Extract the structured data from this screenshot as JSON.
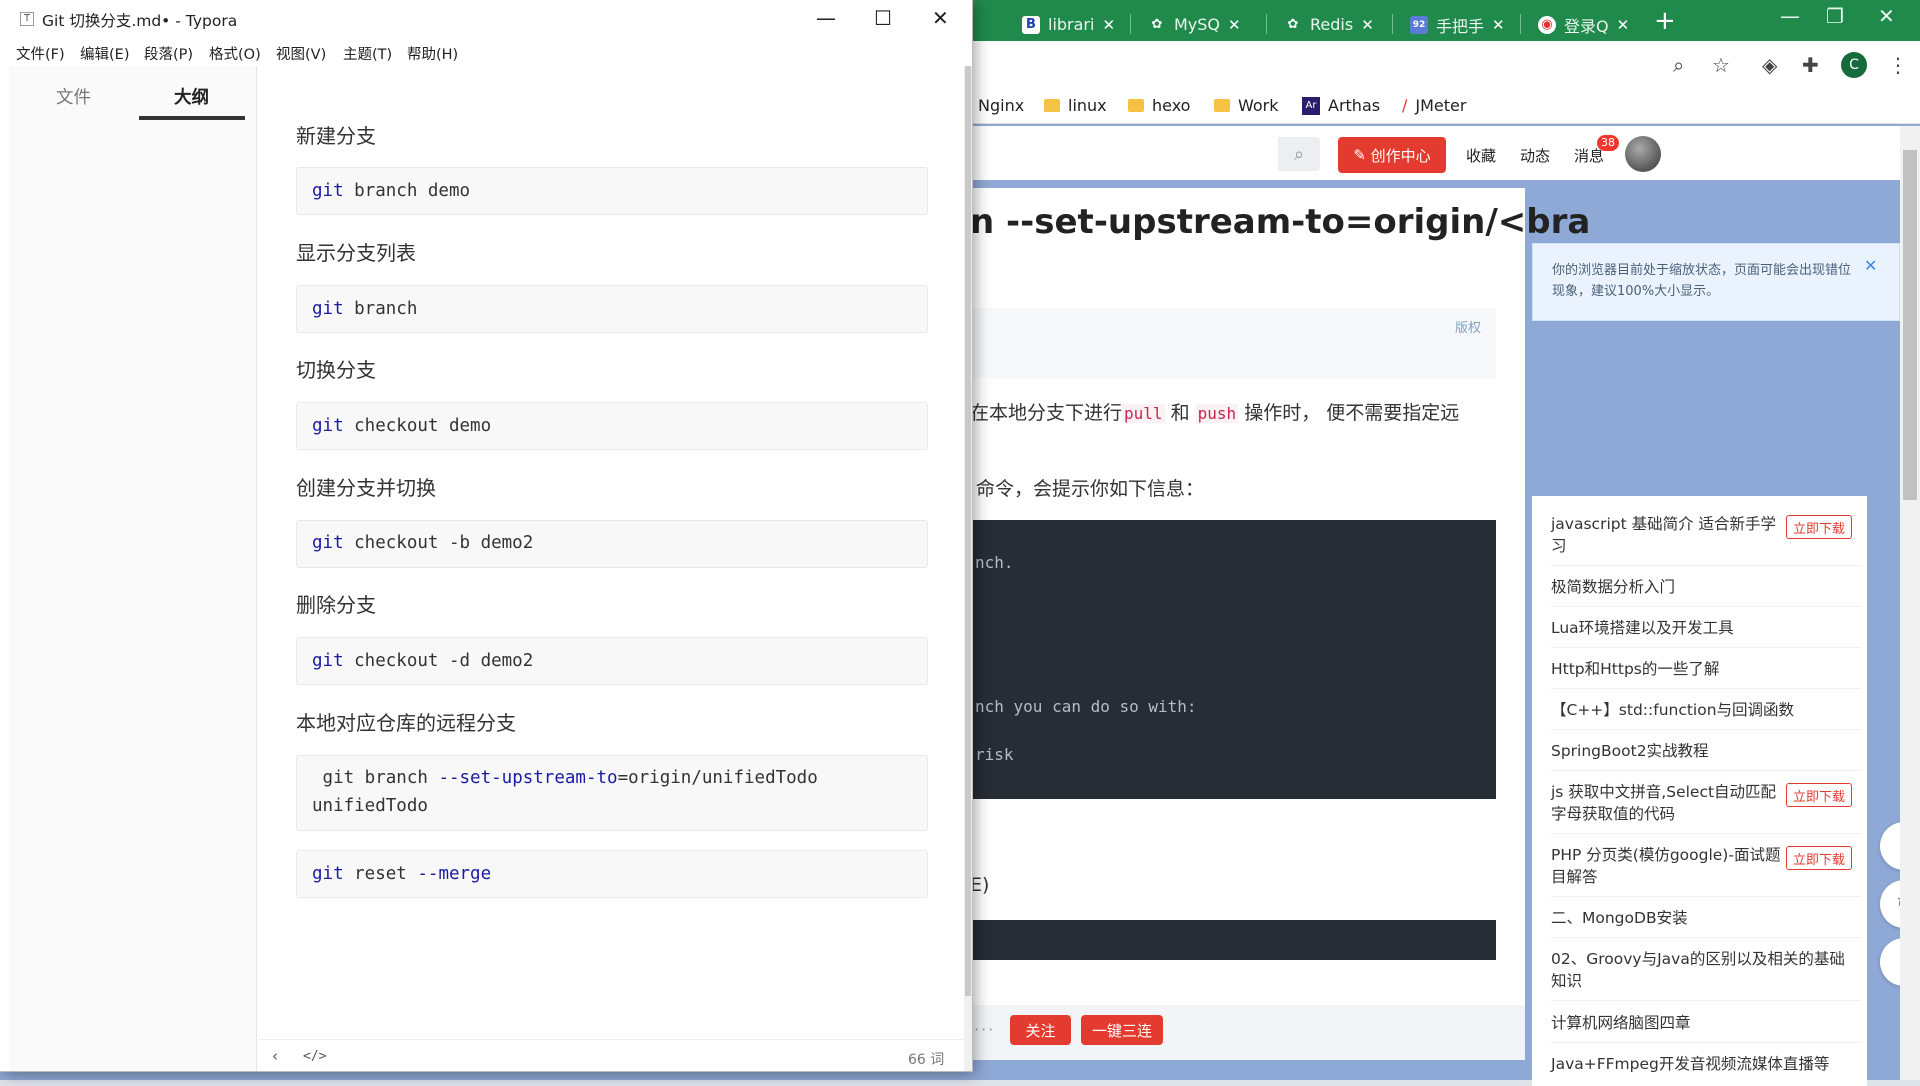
{
  "browser": {
    "tabs": [
      {
        "label": "librari",
        "icon": "B"
      },
      {
        "label": "MySQ",
        "icon": "✿"
      },
      {
        "label": "Redis",
        "icon": "✿"
      },
      {
        "label": "手把手",
        "icon": "92"
      },
      {
        "label": "登录Q",
        "icon": "◉"
      }
    ],
    "bookmarks": [
      "Nginx",
      "linux",
      "hexo",
      "Work",
      "Arthas",
      "JMeter"
    ],
    "profile_letter": "C"
  },
  "csdn": {
    "create_label": "创作中心",
    "nav": [
      "收藏",
      "动态",
      "消息"
    ],
    "msg_count": "38",
    "title_fragment": "n --set-upstream-to=origin/<bra",
    "copyright": "版权",
    "para1_before": "在本地分支下进行",
    "para1_code1": "pull",
    "para1_mid": " 和 ",
    "para1_code2": "push",
    "para1_after": " 操作时， 便不需要指定远",
    "para2": "命令，会提示你如下信息：",
    "code_lines": [
      "nch.",
      "nch you can do so with:",
      "risk"
    ],
    "para3": "E)",
    "dots": "···",
    "follow_label": "关注",
    "triple_label": "一键三连",
    "zoom_tip": "你的浏览器目前处于缩放状态，页面可能会出现错位现象，建议100%大小显示。",
    "download_label": "立即下载",
    "recs": [
      "javascript 基础简介 适合新手学习",
      "极简数据分析入门",
      "Lua环境搭建以及开发工具",
      "Http和Https的一些了解",
      "【C++】std::function与回调函数",
      "SpringBoot2实战教程",
      "js 获取中文拼音,Select自动匹配字母获取值的代码",
      "PHP 分页类(模仿google)-面试题目解答",
      "二、MongoDB安装",
      "02、Groovy与Java的区别以及相关的基础知识",
      "计算机网络脑图四章",
      "Java+FFmpeg开发音视频流媒体直播等"
    ]
  },
  "typora": {
    "title": "Git 切换分支.md• - Typora",
    "menus": [
      "文件(F)",
      "编辑(E)",
      "段落(P)",
      "格式(O)",
      "视图(V)",
      "主题(T)",
      "帮助(H)"
    ],
    "sidebar_tabs": [
      "文件",
      "大纲"
    ],
    "word_count": "66 词",
    "sections": [
      {
        "heading": "新建分支",
        "kw": "git",
        "rest": " branch demo"
      },
      {
        "heading": "显示分支列表",
        "kw": "git",
        "rest": " branch"
      },
      {
        "heading": "切换分支",
        "kw": "git",
        "rest": " checkout demo"
      },
      {
        "heading": "创建分支并切换",
        "kw": "git",
        "rest": " checkout -b demo2"
      },
      {
        "heading": "删除分支",
        "kw": "git",
        "rest": " checkout -d demo2"
      }
    ],
    "remote_heading": "本地对应仓库的远程分支",
    "remote_code_line1_a": " git branch ",
    "remote_code_line1_b": "--set-upstream-to",
    "remote_code_line1_c": "=origin/unifiedTodo",
    "remote_code_line2": "unifiedTodo",
    "reset_kw": "git",
    "reset_mid": " reset ",
    "reset_opt": "--merge"
  }
}
